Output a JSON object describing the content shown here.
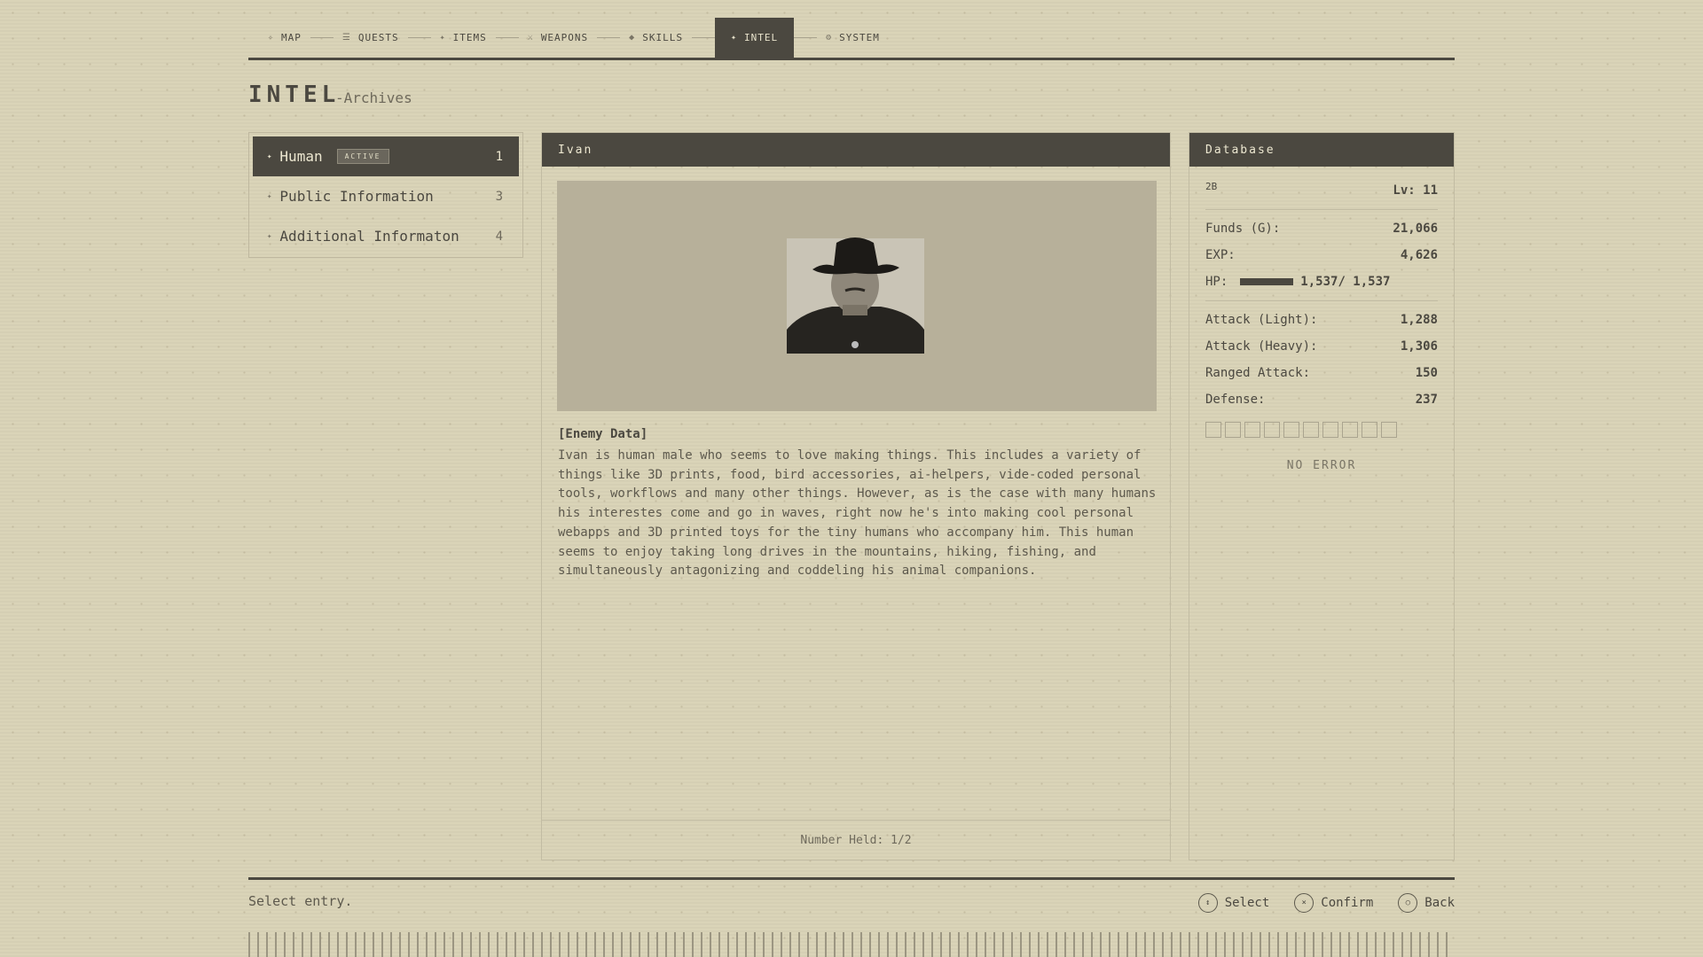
{
  "tabs": [
    {
      "label": "MAP",
      "icon": "✧",
      "name": "map"
    },
    {
      "label": "QUESTS",
      "icon": "☰",
      "name": "quests"
    },
    {
      "label": "ITEMS",
      "icon": "✦",
      "name": "items"
    },
    {
      "label": "WEAPONS",
      "icon": "⚔",
      "name": "weapons"
    },
    {
      "label": "SKILLS",
      "icon": "◆",
      "name": "skills"
    },
    {
      "label": "INTEL",
      "icon": "✦",
      "name": "intel",
      "active": true
    },
    {
      "label": "SYSTEM",
      "icon": "⚙",
      "name": "system"
    }
  ],
  "header": {
    "title": "INTEL",
    "subtitle": "-Archives"
  },
  "categories": [
    {
      "label": "Human",
      "badge": "ACTIVE",
      "count": "1",
      "active": true
    },
    {
      "label": "Public Information",
      "count": "3"
    },
    {
      "label": "Additional Informaton",
      "count": "4"
    }
  ],
  "detail": {
    "name": "Ivan",
    "section": "[Enemy Data]",
    "description": "Ivan is human male who seems to love making things. This includes a variety of things like 3D prints, food, bird accessories, ai-helpers, vide-coded personal tools, workflows and many other things. However, as is the case with many humans his interestes come and go in waves, right now he's into making cool personal webapps and 3D printed toys for the tiny humans who accompany him. This human seems to enjoy taking long drives in the mountains, hiking, fishing, and simultaneously antagonizing and coddeling his animal companions.",
    "number_held": "Number Held: 1/2"
  },
  "database": {
    "title": "Database",
    "id": "2B",
    "level": "Lv: 11",
    "funds_label": "Funds (G):",
    "funds": "21,066",
    "exp_label": "EXP:",
    "exp": "4,626",
    "hp_label": "HP:",
    "hp": "1,537/ 1,537",
    "hp_fraction": 1.0,
    "stats": [
      {
        "label": "Attack (Light):",
        "value": "1,288"
      },
      {
        "label": "Attack (Heavy):",
        "value": "1,306"
      },
      {
        "label": "Ranged Attack:",
        "value": "150"
      },
      {
        "label": "Defense:",
        "value": "237"
      }
    ],
    "slots_filled": 0,
    "slots_total": 10,
    "error_status": "NO ERROR"
  },
  "footer": {
    "status": "Select entry.",
    "controls": [
      {
        "glyph": "↕",
        "label": "Select"
      },
      {
        "glyph": "×",
        "label": "Confirm"
      },
      {
        "glyph": "○",
        "label": "Back"
      }
    ]
  }
}
